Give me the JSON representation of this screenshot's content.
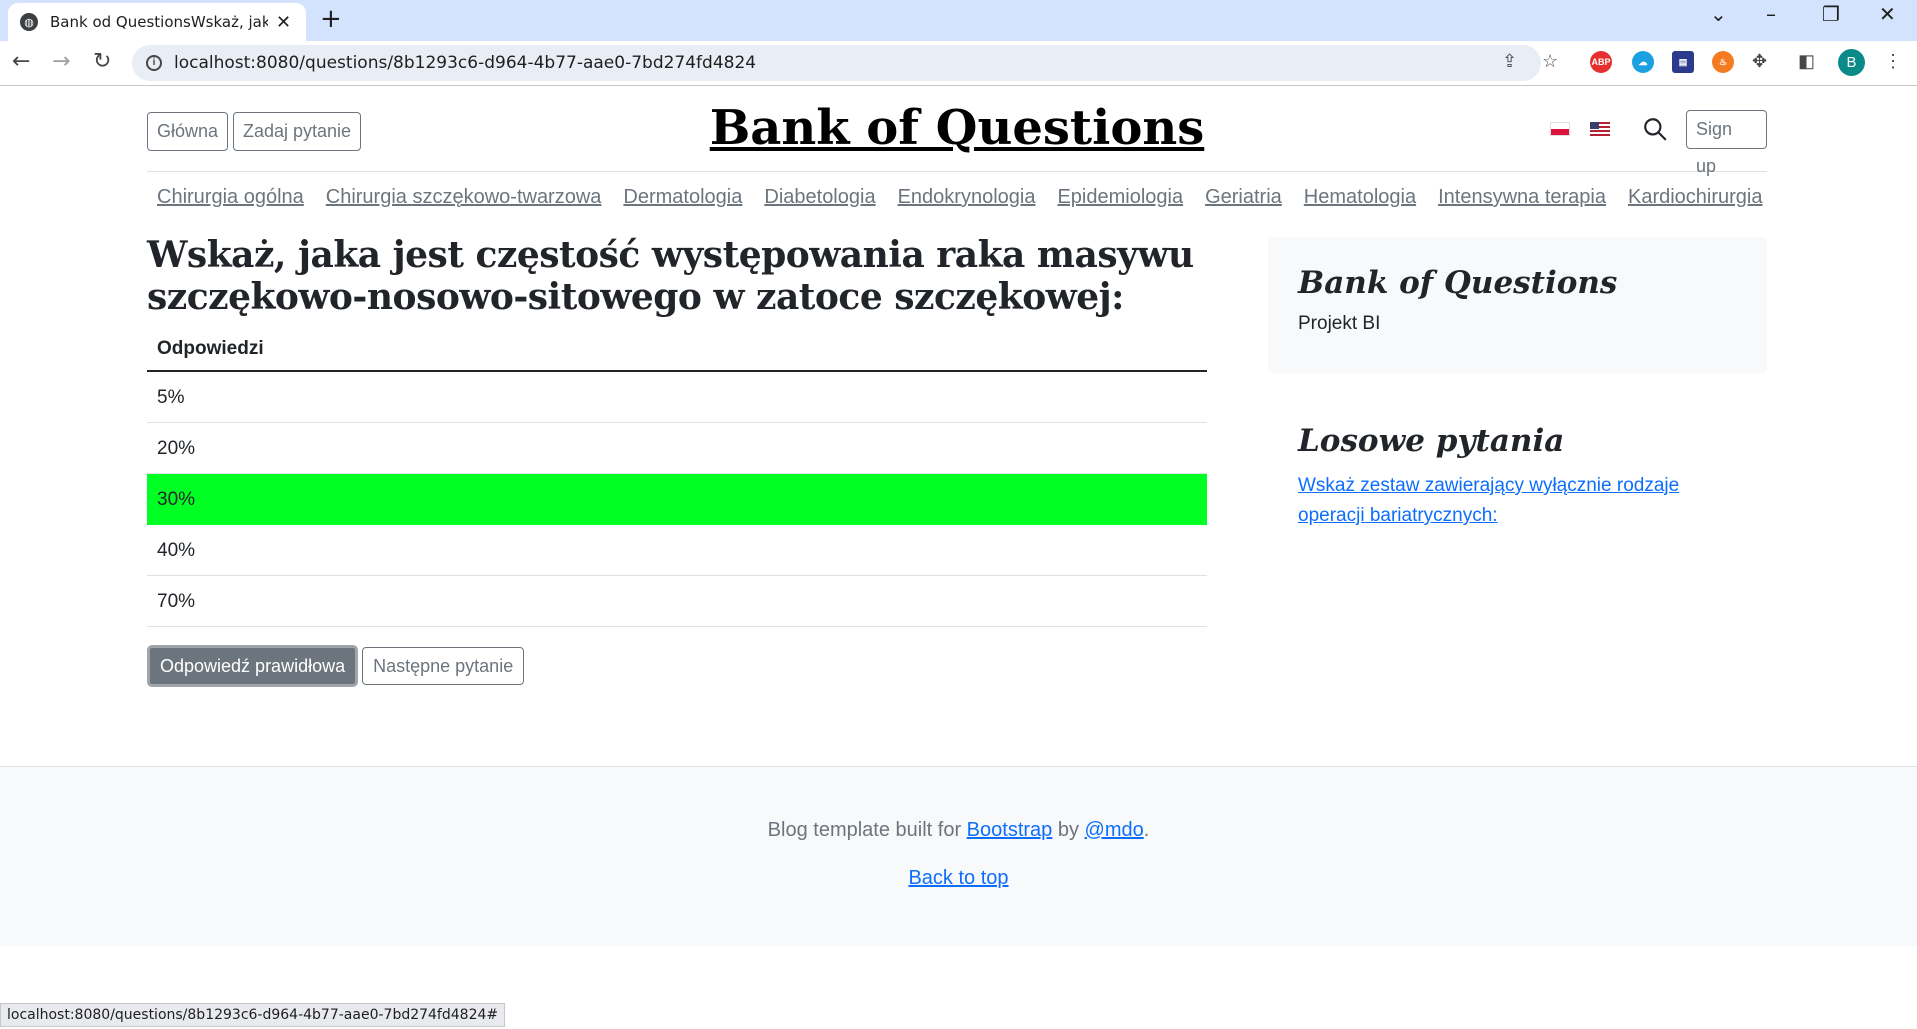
{
  "browser": {
    "tab_title": "Bank od QuestionsWskaż, jaka jest",
    "url": "localhost:8080/questions/8b1293c6-d964-4b77-aae0-7bd274fd4824",
    "profile_initial": "B",
    "status_url": "localhost:8080/questions/8b1293c6-d964-4b77-aae0-7bd274fd4824#"
  },
  "header": {
    "home_label": "Główna",
    "ask_label": "Zadaj pytanie",
    "logo": "Bank of Questions",
    "signup_label": "Sign up"
  },
  "categories": [
    "Chirurgia ogólna",
    "Chirurgia szczękowo-twarzowa",
    "Dermatologia",
    "Diabetologia",
    "Endokrynologia",
    "Epidemiologia",
    "Geriatria",
    "Hematologia",
    "Intensywna terapia",
    "Kardiochirurgia"
  ],
  "question": {
    "title": "Wskaż, jaka jest częstość występowania raka masywu szczękowo-nosowo-sitowego w zatoce szczękowej:",
    "answers_header": "Odpowiedzi",
    "answers": [
      "5%",
      "20%",
      "30%",
      "40%",
      "70%"
    ],
    "correct_index": 2,
    "correct_button": "Odpowiedź prawidłowa",
    "next_button": "Następne pytanie"
  },
  "sidebar": {
    "about_title": "Bank of Questions",
    "about_text": "Projekt BI",
    "random_title": "Losowe pytania",
    "random_link": "Wskaż zestaw zawierający wyłącznie rodzaje operacji bariatrycznych:"
  },
  "footer": {
    "prefix": "Blog template built for ",
    "bootstrap": "Bootstrap",
    "by": " by ",
    "mdo": "@mdo",
    "dot": ".",
    "back_to_top": "Back to top"
  },
  "colors": {
    "correct": "#00ff22",
    "link": "#0d6efd"
  }
}
